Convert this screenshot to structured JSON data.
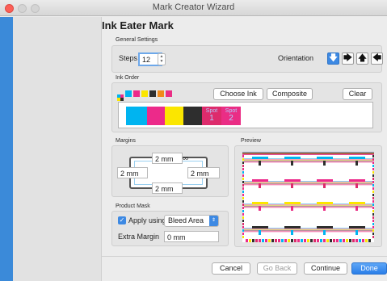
{
  "window": {
    "title": "Mark Creator Wizard"
  },
  "page": {
    "heading": "Ink Eater Mark"
  },
  "general_settings": {
    "group_label": "General Settings",
    "steps_label": "Steps",
    "steps_value": "12",
    "orientation_label": "Orientation",
    "orientation_options": [
      "down",
      "right",
      "up",
      "left"
    ],
    "orientation_selected": "down"
  },
  "ink_order": {
    "group_label": "Ink Order",
    "choose_ink_label": "Choose Ink",
    "composite_label": "Composite",
    "clear_label": "Clear",
    "inks": [
      {
        "name": "Cyan",
        "color": "#00b4f0"
      },
      {
        "name": "Magenta",
        "color": "#ec2a8a"
      },
      {
        "name": "Yellow",
        "color": "#fbe600"
      },
      {
        "name": "Black",
        "color": "#2e2e2e"
      },
      {
        "name": "Spot",
        "number": "1",
        "color": "#dd2b6c"
      },
      {
        "name": "Spot",
        "number": "2",
        "color": "#ea2d85"
      }
    ]
  },
  "margins": {
    "group_label": "Margins",
    "top": "2 mm",
    "left": "2 mm",
    "right": "2 mm",
    "bottom": "2 mm"
  },
  "preview": {
    "group_label": "Preview"
  },
  "product_mask": {
    "group_label": "Product Mask",
    "apply_using_label": "Apply using",
    "apply_using_checked": true,
    "apply_using_value": "Bleed Area",
    "extra_margin_label": "Extra Margin",
    "extra_margin_value": "0 mm"
  },
  "footer": {
    "cancel_label": "Cancel",
    "go_back_label": "Go Back",
    "continue_label": "Continue",
    "done_label": "Done"
  }
}
